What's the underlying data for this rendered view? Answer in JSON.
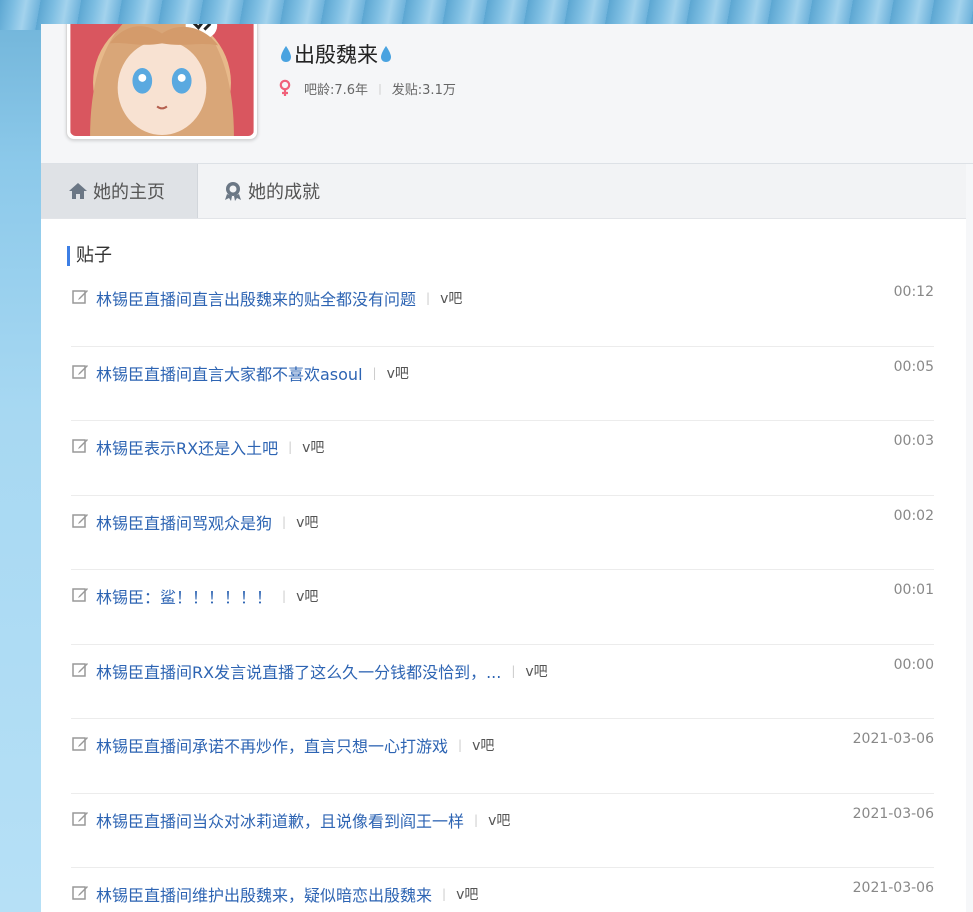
{
  "profile": {
    "name": "出殷魏来",
    "age_label": "吧龄:7.6年",
    "posts_label": "发贴:3.1万"
  },
  "tabs": [
    {
      "label": "她的主页",
      "active": true,
      "icon": "home-icon"
    },
    {
      "label": "她的成就",
      "active": false,
      "icon": "badge-icon"
    }
  ],
  "section": {
    "title": "贴子"
  },
  "posts": [
    {
      "title": "林锡臣直播间直言出殷魏来的贴全都没有问题",
      "forum": "v吧",
      "time": "00:12"
    },
    {
      "title": "林锡臣直播间直言大家都不喜欢asoul",
      "forum": "v吧",
      "time": "00:05"
    },
    {
      "title": "林锡臣表示RX还是入土吧",
      "forum": "v吧",
      "time": "00:03"
    },
    {
      "title": "林锡臣直播间骂观众是狗",
      "forum": "v吧",
      "time": "00:02"
    },
    {
      "title": "林锡臣：鲨！！！！！！",
      "forum": "v吧",
      "time": "00:01"
    },
    {
      "title": "林锡臣直播间RX发言说直播了这么久一分钱都没恰到，...",
      "forum": "v吧",
      "time": "00:00"
    },
    {
      "title": "林锡臣直播间承诺不再炒作，直言只想一心打游戏",
      "forum": "v吧",
      "time": "2021-03-06"
    },
    {
      "title": "林锡臣直播间当众对冰莉道歉，且说像看到阎王一样",
      "forum": "v吧",
      "time": "2021-03-06"
    },
    {
      "title": "林锡臣直播间维护出殷魏来，疑似暗恋出殷魏来",
      "forum": "v吧",
      "time": "2021-03-06"
    }
  ],
  "colors": {
    "link": "#2d64b3",
    "accent": "#3d7fe5",
    "female": "#f0617a",
    "drop": "#4aa3e0"
  }
}
